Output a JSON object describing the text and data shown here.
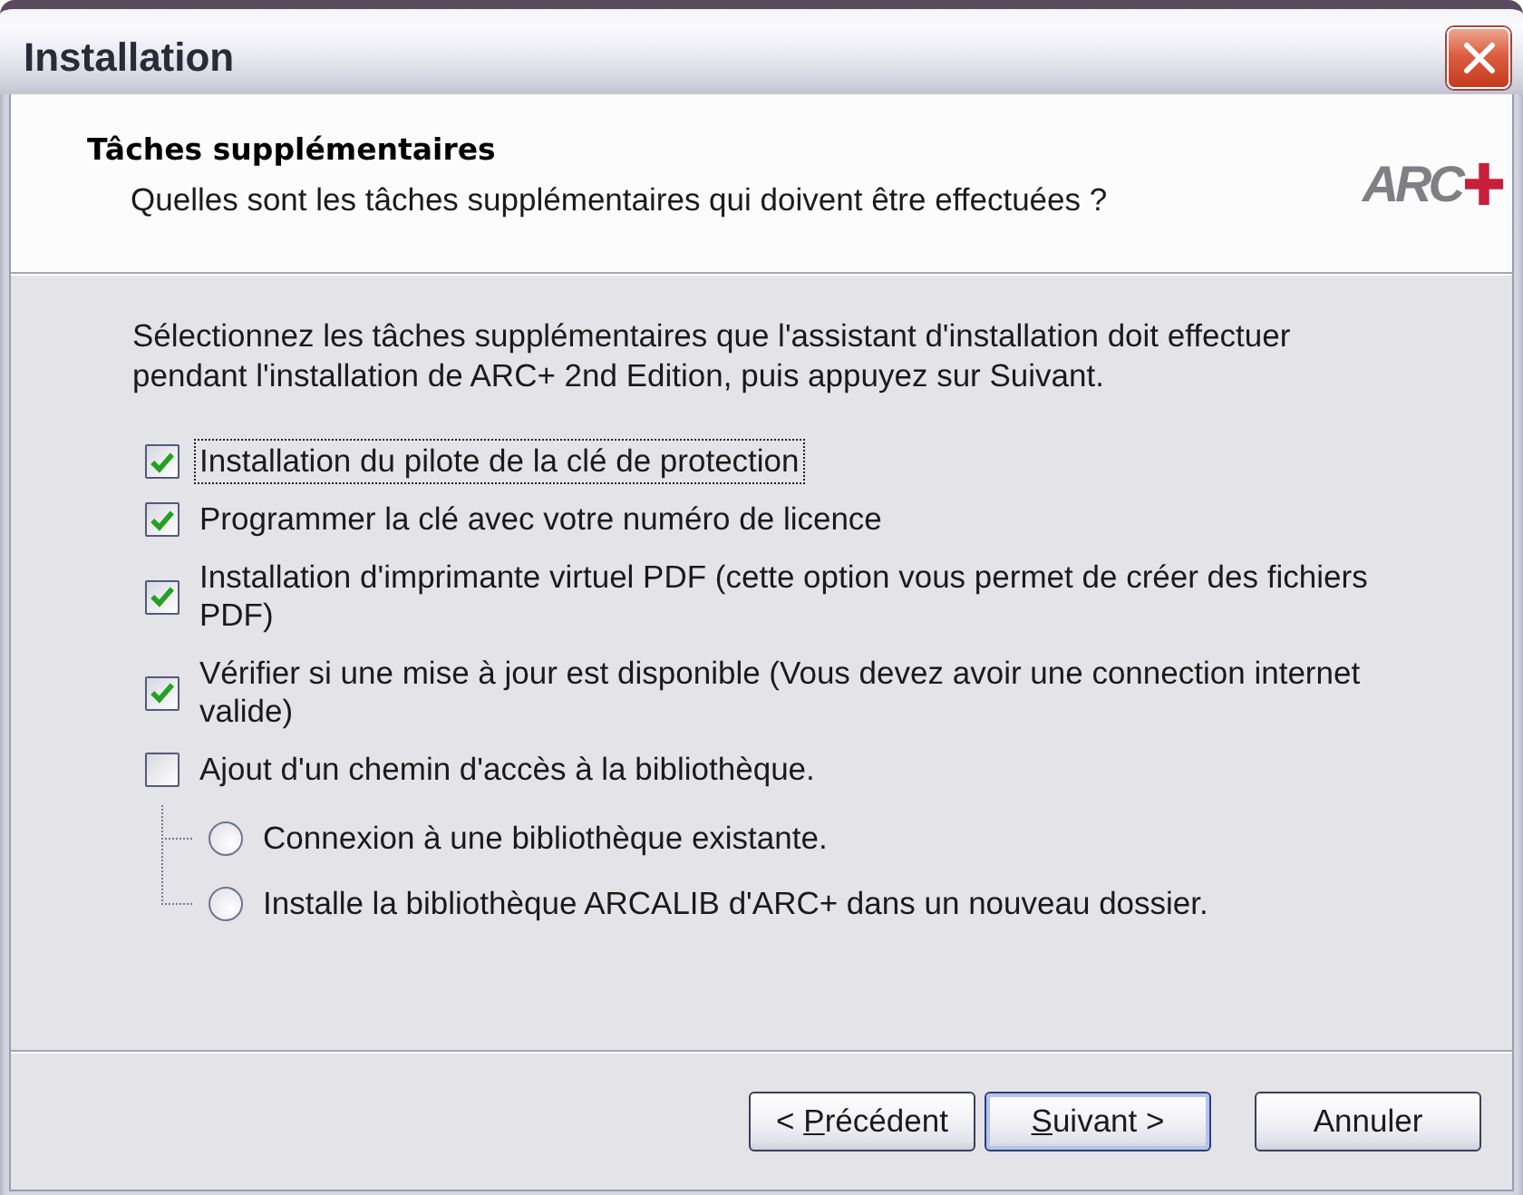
{
  "window": {
    "title": "Installation"
  },
  "header": {
    "title": "Tâches supplémentaires",
    "subtitle": "Quelles sont les tâches supplémentaires qui doivent être effectuées ?",
    "logo": {
      "text": "ARC"
    }
  },
  "intro": "Sélectionnez les tâches supplémentaires que l'assistant d'installation doit effectuer pendant l'installation de ARC+ 2nd Edition, puis appuyez sur Suivant.",
  "tasks": [
    {
      "kind": "checkbox",
      "label": "Installation du pilote de la clé de protection",
      "checked": true,
      "focused": true
    },
    {
      "kind": "checkbox",
      "label": "Programmer la clé avec votre numéro de licence",
      "checked": true,
      "focused": false
    },
    {
      "kind": "checkbox",
      "label": "Installation d'imprimante virtuel PDF (cette option vous permet de créer des fichiers PDF)",
      "checked": true,
      "focused": false
    },
    {
      "kind": "checkbox",
      "label": "Vérifier si une mise à jour est disponible (Vous devez avoir une connection internet valide)",
      "checked": true,
      "focused": false
    },
    {
      "kind": "checkbox",
      "label": "Ajout d'un chemin d'accès à la bibliothèque.",
      "checked": false,
      "focused": false,
      "children": [
        {
          "kind": "radio",
          "label": "Connexion à une bibliothèque existante.",
          "selected": false
        },
        {
          "kind": "radio",
          "label": "Installe la bibliothèque ARCALIB d'ARC+ dans un nouveau dossier.",
          "selected": false
        }
      ]
    }
  ],
  "buttons": [
    {
      "kind": "back",
      "pre": "< ",
      "key": "P",
      "post": "récédent",
      "default": false
    },
    {
      "kind": "next",
      "key": "S",
      "post": "uivant >",
      "default": true
    },
    {
      "kind": "cancel",
      "pre": "Annuler",
      "default": false
    }
  ]
}
